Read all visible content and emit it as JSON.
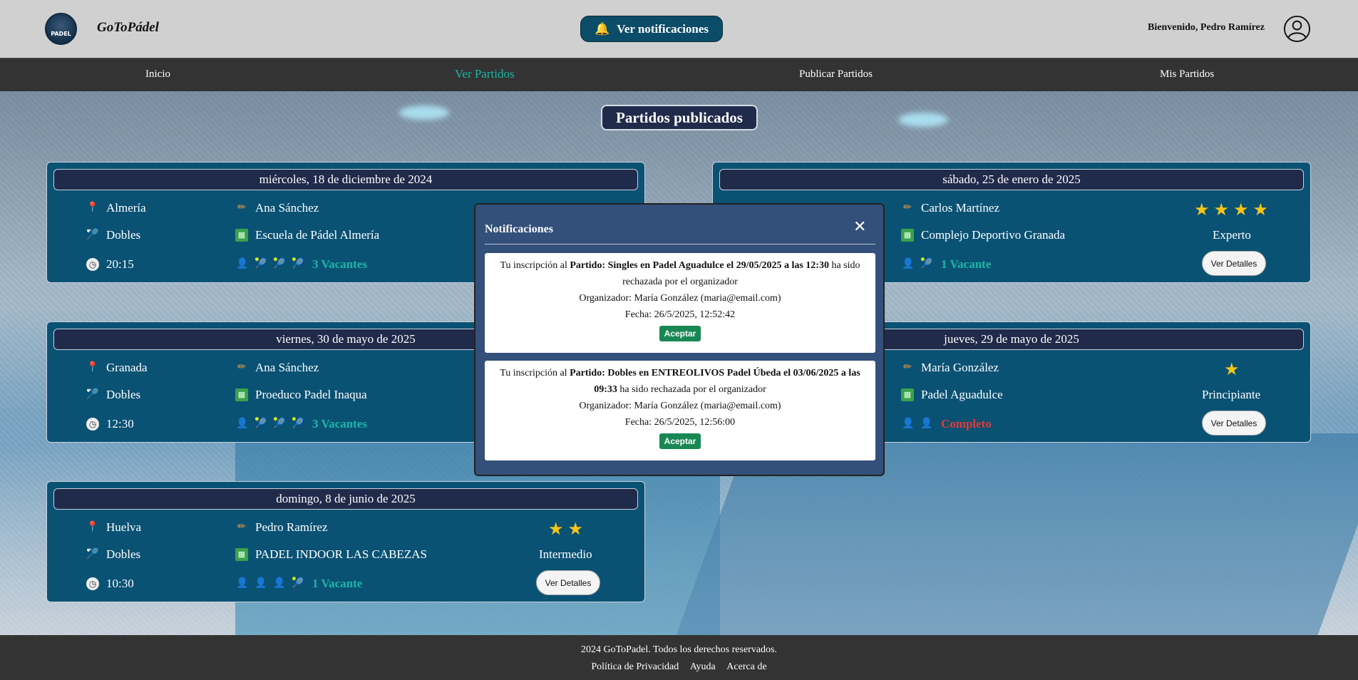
{
  "header": {
    "app_title": "GoToPádel",
    "logo_text": "PADEL",
    "notifications_button": "Ver notificaciones",
    "welcome": "Bienvenido, Pedro Ramírez"
  },
  "nav": {
    "items": [
      {
        "label": "Inicio"
      },
      {
        "label": "Ver Partidos"
      },
      {
        "label": "Publicar Partidos"
      },
      {
        "label": "Mis Partidos"
      }
    ],
    "active_index": 1
  },
  "main": {
    "title": "Partidos publicados",
    "details_label": "Ver Detalles",
    "cards": [
      {
        "date": "miércoles, 18 de diciembre de 2024",
        "city": "Almería",
        "organizer": "Ana Sánchez",
        "mode": "Dobles",
        "venue": "Escuela de Pádel Almería",
        "time": "20:15",
        "availability": "3 Vacantes",
        "stars": 0,
        "level": ""
      },
      {
        "date": "sábado, 25 de enero de 2025",
        "city": "",
        "organizer": "Carlos Martínez",
        "mode": "",
        "venue": "Complejo Deportivo Granada",
        "time": "",
        "availability": "1 Vacante",
        "stars": 4,
        "level": "Experto"
      },
      {
        "date": "viernes, 30 de mayo de 2025",
        "city": "Granada",
        "organizer": "Ana Sánchez",
        "mode": "Dobles",
        "venue": "Proeduco Padel Inaqua",
        "time": "12:30",
        "availability": "3 Vacantes",
        "stars": 0,
        "level": ""
      },
      {
        "date": "jueves, 29 de mayo de 2025",
        "city": "",
        "organizer": "María González",
        "mode": "",
        "venue": "Padel Aguadulce",
        "time": "",
        "availability": "Completo",
        "stars": 1,
        "level": "Principiante"
      },
      {
        "date": "domingo, 8 de junio de 2025",
        "city": "Huelva",
        "organizer": "Pedro Ramírez",
        "mode": "Dobles",
        "venue": "PADEL INDOOR LAS CABEZAS",
        "time": "10:30",
        "availability": "1 Vacante",
        "stars": 2,
        "level": "Intermedio"
      }
    ]
  },
  "modal": {
    "title": "Notificaciones",
    "accept_label": "Aceptar",
    "notifications": [
      {
        "prefix": "Tu inscripción al ",
        "match": "Partido: Singles en Padel Aguadulce el 29/05/2025 a las 12:30",
        "suffix": " ha sido rechazada por el organizador",
        "organizer": "Organizador: María González (maria@email.com)",
        "date": "Fecha: 26/5/2025, 12:52:42"
      },
      {
        "prefix": "Tu inscripción al ",
        "match": "Partido: Dobles en ENTREOLIVOS Padel Úbeda el 03/06/2025 a las 09:33",
        "suffix": " ha sido rechazada por el organizador",
        "organizer": "Organizador: María González (maria@email.com)",
        "date": "Fecha: 26/5/2025, 12:56:00"
      }
    ]
  },
  "footer": {
    "copyright": "2024 GoToPadel. Todos los derechos reservados.",
    "links": [
      "Política de Privacidad",
      "Ayuda",
      "Acerca de"
    ]
  }
}
